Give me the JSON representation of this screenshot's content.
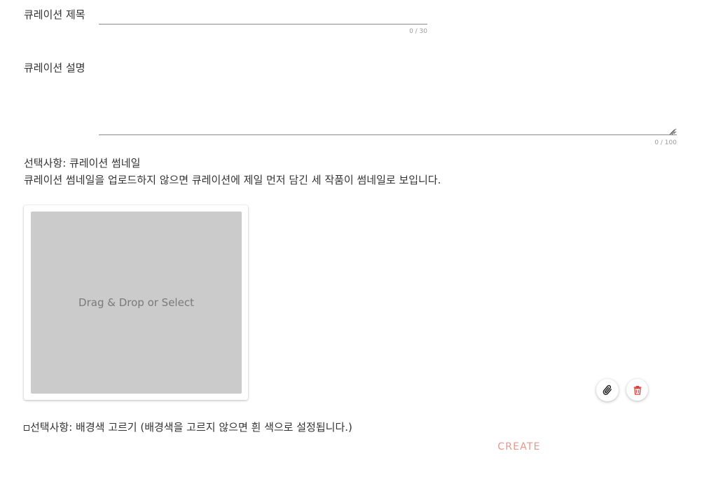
{
  "form": {
    "title_label": "큐레이션 제목",
    "title_value": "",
    "title_counter": "0 / 30",
    "description_label": "큐레이션 설명",
    "description_value": "",
    "description_counter": "0 / 100"
  },
  "thumbnail": {
    "section_title": "선택사항: 큐레이션 썸네일",
    "help_text": "큐레이션 썸네일을 업로드하지 않으면 큐레이션에 제일 먼저 담긴 세 작품이 썸네일로 보입니다.",
    "dropzone_text": "Drag & Drop or Select",
    "attach_icon": "paperclip-icon",
    "delete_icon": "trash-icon",
    "delete_color": "#e53935"
  },
  "background": {
    "checked": false,
    "label": "선택사항: 배경색 고르기 (배경색을 고르지 않으면 흰 색으로 설정됩니다.)"
  },
  "actions": {
    "create_label": "CREATE",
    "create_color": "#e8968c"
  }
}
